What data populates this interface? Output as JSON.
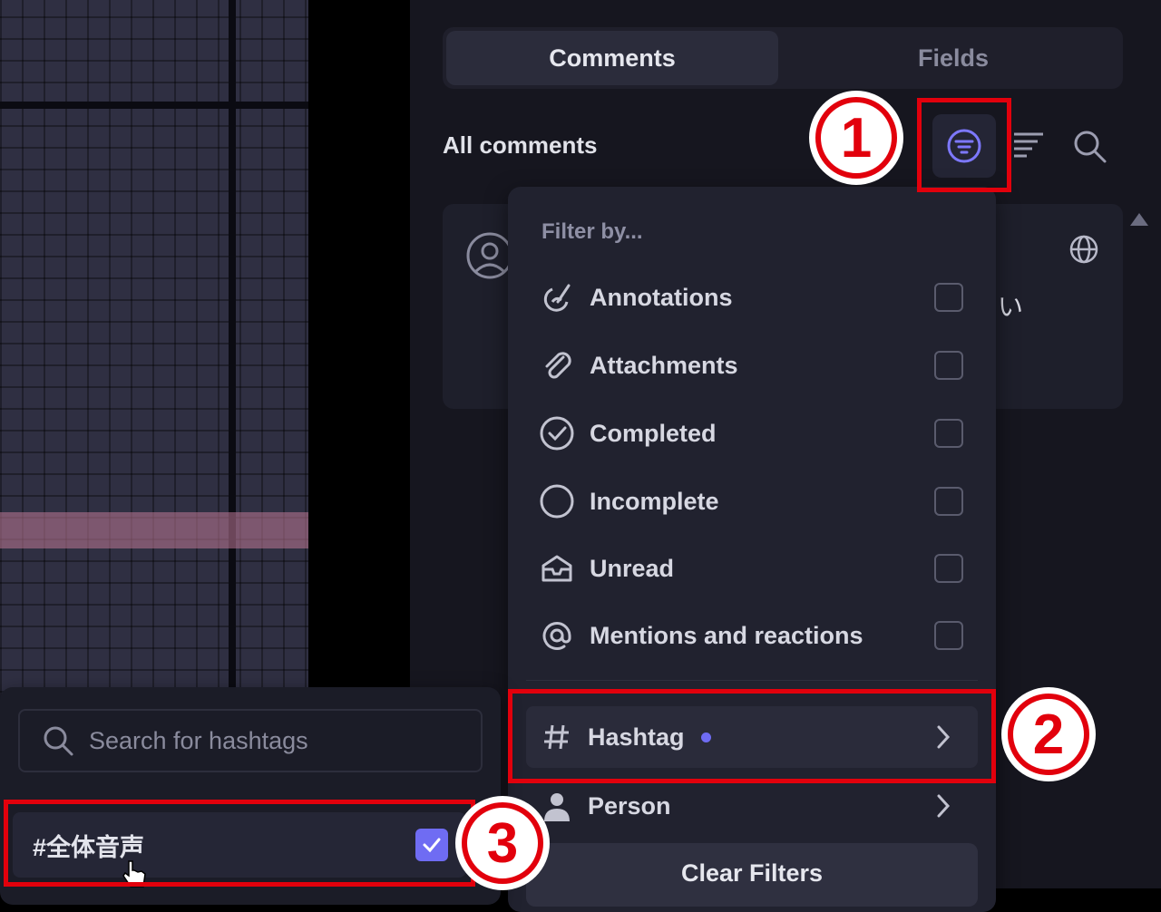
{
  "tabs": [
    {
      "label": "Comments",
      "active": true
    },
    {
      "label": "Fields",
      "active": false
    }
  ],
  "header": {
    "title": "All comments"
  },
  "comment_card": {
    "partial_text": "い"
  },
  "filter_menu": {
    "header": "Filter by...",
    "items": [
      {
        "label": "Annotations",
        "icon": "annotation-icon",
        "checked": false
      },
      {
        "label": "Attachments",
        "icon": "paperclip-icon",
        "checked": false
      },
      {
        "label": "Completed",
        "icon": "check-circle-icon",
        "checked": false
      },
      {
        "label": "Incomplete",
        "icon": "circle-icon",
        "checked": false
      },
      {
        "label": "Unread",
        "icon": "inbox-icon",
        "checked": false
      },
      {
        "label": "Mentions and reactions",
        "icon": "at-icon",
        "checked": false
      }
    ],
    "hashtag_label": "Hashtag",
    "person_label": "Person",
    "clear_label": "Clear Filters"
  },
  "hashtag_popover": {
    "search_placeholder": "Search for hashtags",
    "items": [
      {
        "label": "#全体音声",
        "checked": true
      }
    ]
  },
  "annotations": {
    "step1": "1",
    "step2": "2",
    "step3": "3"
  },
  "colors": {
    "accent": "#6f6cf3",
    "annotation_red": "#e2000c",
    "panel_bg": "#16161f"
  }
}
